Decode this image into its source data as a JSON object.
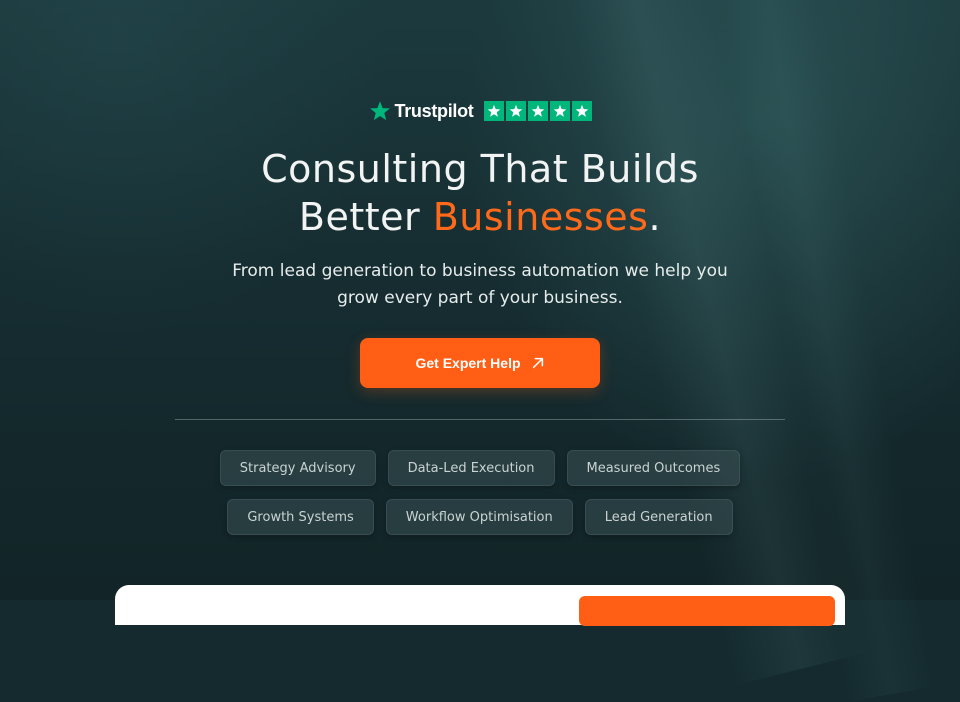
{
  "trustpilot": {
    "brand": "Trustpilot",
    "star_color": "#00b67a",
    "rating": 5,
    "icon": "star-icon"
  },
  "hero": {
    "title_line1": "Consulting That Builds",
    "title_line2_prefix": "Better ",
    "title_line2_accent": "Businesses",
    "title_line2_suffix": ".",
    "accent_color": "#ff6a1a",
    "subtitle_line1": "From lead generation to business automation we help you",
    "subtitle_line2": "grow every part of your business."
  },
  "cta": {
    "label": "Get Expert Help",
    "icon": "arrow-up-right-icon",
    "color": "#ff5e14"
  },
  "tags": {
    "row1": [
      "Strategy Advisory",
      "Data-Led Execution",
      "Measured Outcomes"
    ],
    "row2": [
      "Growth Systems",
      "Workflow Optimisation",
      "Lead Generation"
    ]
  }
}
